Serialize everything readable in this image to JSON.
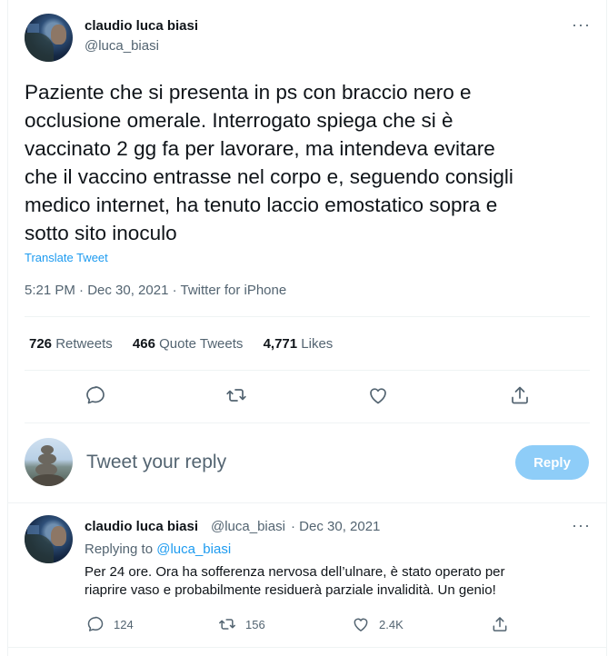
{
  "main_tweet": {
    "author_name": "claudio luca biasi",
    "author_handle": "@luca_biasi",
    "text_lines": [
      "Paziente che si presenta in ps con braccio nero e",
      "occlusione  omerale. Interrogato spiega che si è",
      "vaccinato 2 gg fa per lavorare, ma intendeva evitare",
      "che il vaccino entrasse nel corpo e, seguendo consigli",
      "medico internet, ha tenuto laccio emostatico sopra e",
      "sotto sito inoculo"
    ],
    "translate_label": "Translate Tweet",
    "meta": "5:21 PM · Dec 30, 2021 · Twitter for iPhone",
    "stats": {
      "retweets_count": "726",
      "retweets_label": "Retweets",
      "quotes_count": "466",
      "quotes_label": "Quote Tweets",
      "likes_count": "4,771",
      "likes_label": "Likes"
    },
    "more_label": "···"
  },
  "compose": {
    "placeholder": "Tweet your reply",
    "reply_button": "Reply"
  },
  "reply_tweet": {
    "author_name": "claudio luca biasi",
    "author_handle": "@luca_biasi",
    "date": "· Dec 30, 2021",
    "replying_label": "Replying to",
    "replying_handle": "@luca_biasi",
    "text_lines": [
      "Per 24 ore. Ora ha sofferenza nervosa dell’ulnare, è stato operato per",
      "riaprire vaso e probabilmente residuerà parziale invalidità. Un genio!"
    ],
    "reply_count": "124",
    "retweet_count": "156",
    "like_count": "2.4K",
    "more_label": "···"
  },
  "colors": {
    "accent": "#1d9bf0",
    "reply_button_disabled": "#8ecdf8",
    "secondary_text": "#536471",
    "primary_text": "#0f1419"
  },
  "icons": [
    "reply-icon",
    "retweet-icon",
    "like-icon",
    "share-icon",
    "more-icon"
  ]
}
